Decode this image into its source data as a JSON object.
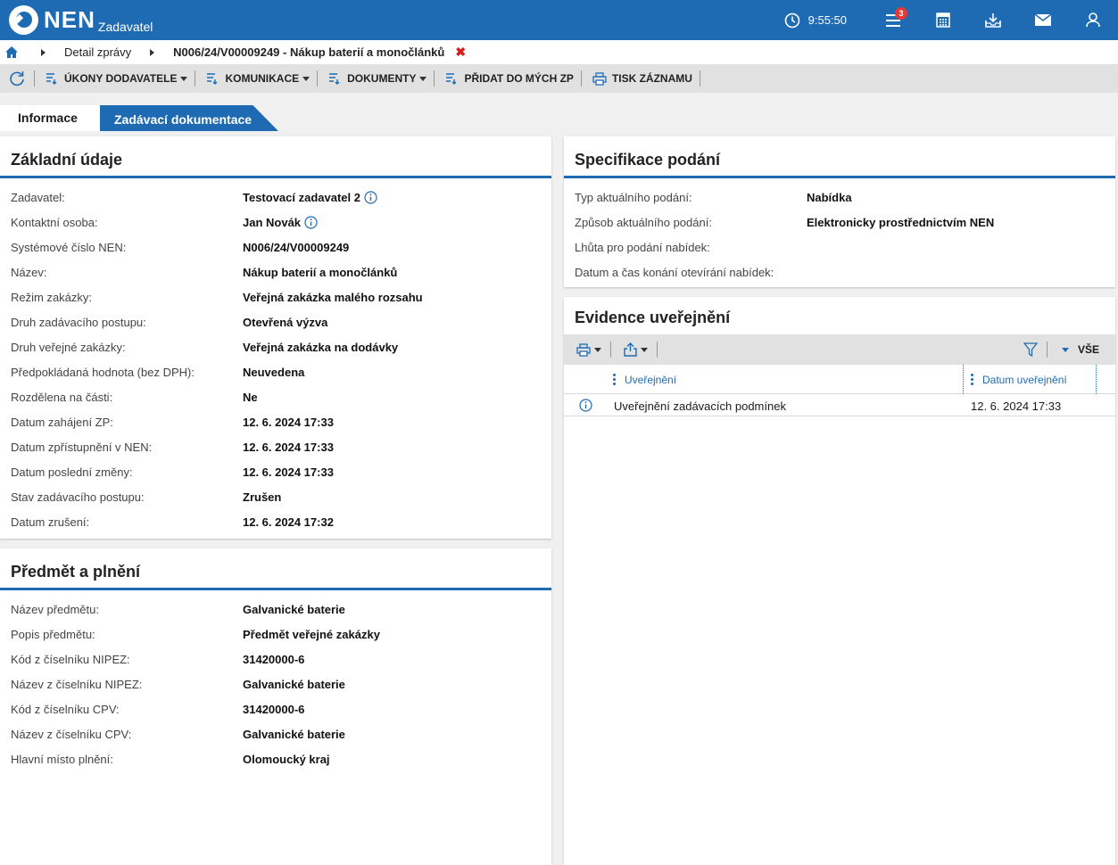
{
  "app": {
    "logo": "NEN",
    "role": "Zadavatel",
    "time": "9:55:50",
    "notification_count": "3"
  },
  "breadcrumb": {
    "item1": "Detail zprávy",
    "current": "N006/24/V00009249 - Nákup baterií a monočlánků",
    "close": "✖"
  },
  "toolbar": {
    "ukony": "ÚKONY DODAVATELE",
    "komunikace": "KOMUNIKACE",
    "dokumenty": "DOKUMENTY",
    "pridat": "PŘIDAT DO MÝCH ZP",
    "tisk": "TISK ZÁZNAMU"
  },
  "tabs": {
    "active": "Informace",
    "inactive": "Zadávací dokumentace"
  },
  "zakladni": {
    "title": "Základní údaje",
    "rows": [
      {
        "label": "Zadavatel:",
        "value": "Testovací zadavatel 2"
      },
      {
        "label": "Kontaktní osoba:",
        "value": "Jan Novák"
      },
      {
        "label": "Systémové číslo NEN:",
        "value": "N006/24/V00009249"
      },
      {
        "label": "Název:",
        "value": "Nákup baterií a monočlánků"
      },
      {
        "label": "Režim zakázky:",
        "value": "Veřejná zakázka malého rozsahu"
      },
      {
        "label": "Druh zadávacího postupu:",
        "value": "Otevřená výzva"
      },
      {
        "label": "Druh veřejné zakázky:",
        "value": "Veřejná zakázka na dodávky"
      },
      {
        "label": "Předpokládaná hodnota (bez DPH):",
        "value": "Neuvedena"
      },
      {
        "label": "Rozdělena na části:",
        "value": "Ne"
      },
      {
        "label": "Datum zahájení ZP:",
        "value": "12. 6. 2024 17:33"
      },
      {
        "label": "Datum zpřístupnění v NEN:",
        "value": "12. 6. 2024 17:33"
      },
      {
        "label": "Datum poslední změny:",
        "value": "12. 6. 2024 17:33"
      },
      {
        "label": "Stav zadávacího postupu:",
        "value": "Zrušen"
      },
      {
        "label": "Datum zrušení:",
        "value": "12. 6. 2024 17:32"
      }
    ]
  },
  "predmet": {
    "title": "Předmět a plnění",
    "rows": [
      {
        "label": "Název předmětu:",
        "value": "Galvanické baterie"
      },
      {
        "label": "Popis předmětu:",
        "value": "Předmět veřejné zakázky"
      },
      {
        "label": "Kód z číselníku NIPEZ:",
        "value": "31420000-6"
      },
      {
        "label": "Název z číselníku NIPEZ:",
        "value": "Galvanické baterie"
      },
      {
        "label": "Kód z číselníku CPV:",
        "value": "31420000-6"
      },
      {
        "label": "Název z číselníku CPV:",
        "value": "Galvanické baterie"
      },
      {
        "label": "Hlavní místo plnění:",
        "value": "Olomoucký kraj"
      }
    ]
  },
  "specifikace": {
    "title": "Specifikace podání",
    "rows": [
      {
        "label": "Typ aktuálního podání:",
        "value": "Nabídka"
      },
      {
        "label": "Způsob aktuálního podání:",
        "value": "Elektronicky prostřednictvím NEN"
      },
      {
        "label": "Lhůta pro podání nabídek:",
        "value": ""
      },
      {
        "label": "Datum a čas konání otevírání nabídek:",
        "value": ""
      }
    ]
  },
  "evidence": {
    "title": "Evidence uveřejnění",
    "filter_label": "VŠE",
    "columns": [
      "Uveřejnění",
      "Datum uveřejnění"
    ],
    "rows": [
      {
        "name": "Uveřejnění zadávacích podmínek",
        "date": "12. 6. 2024 17:33"
      }
    ]
  },
  "colors": {
    "brand": "#1f6bb3",
    "close": "#d32020",
    "badge": "#e53935"
  },
  "icons": [
    "home-icon",
    "clock-icon",
    "menu-icon",
    "calculator-icon",
    "download-icon",
    "mail-icon",
    "user-icon",
    "refresh-icon",
    "list-icon",
    "printer-icon",
    "info-icon",
    "share-icon",
    "filter-icon"
  ]
}
